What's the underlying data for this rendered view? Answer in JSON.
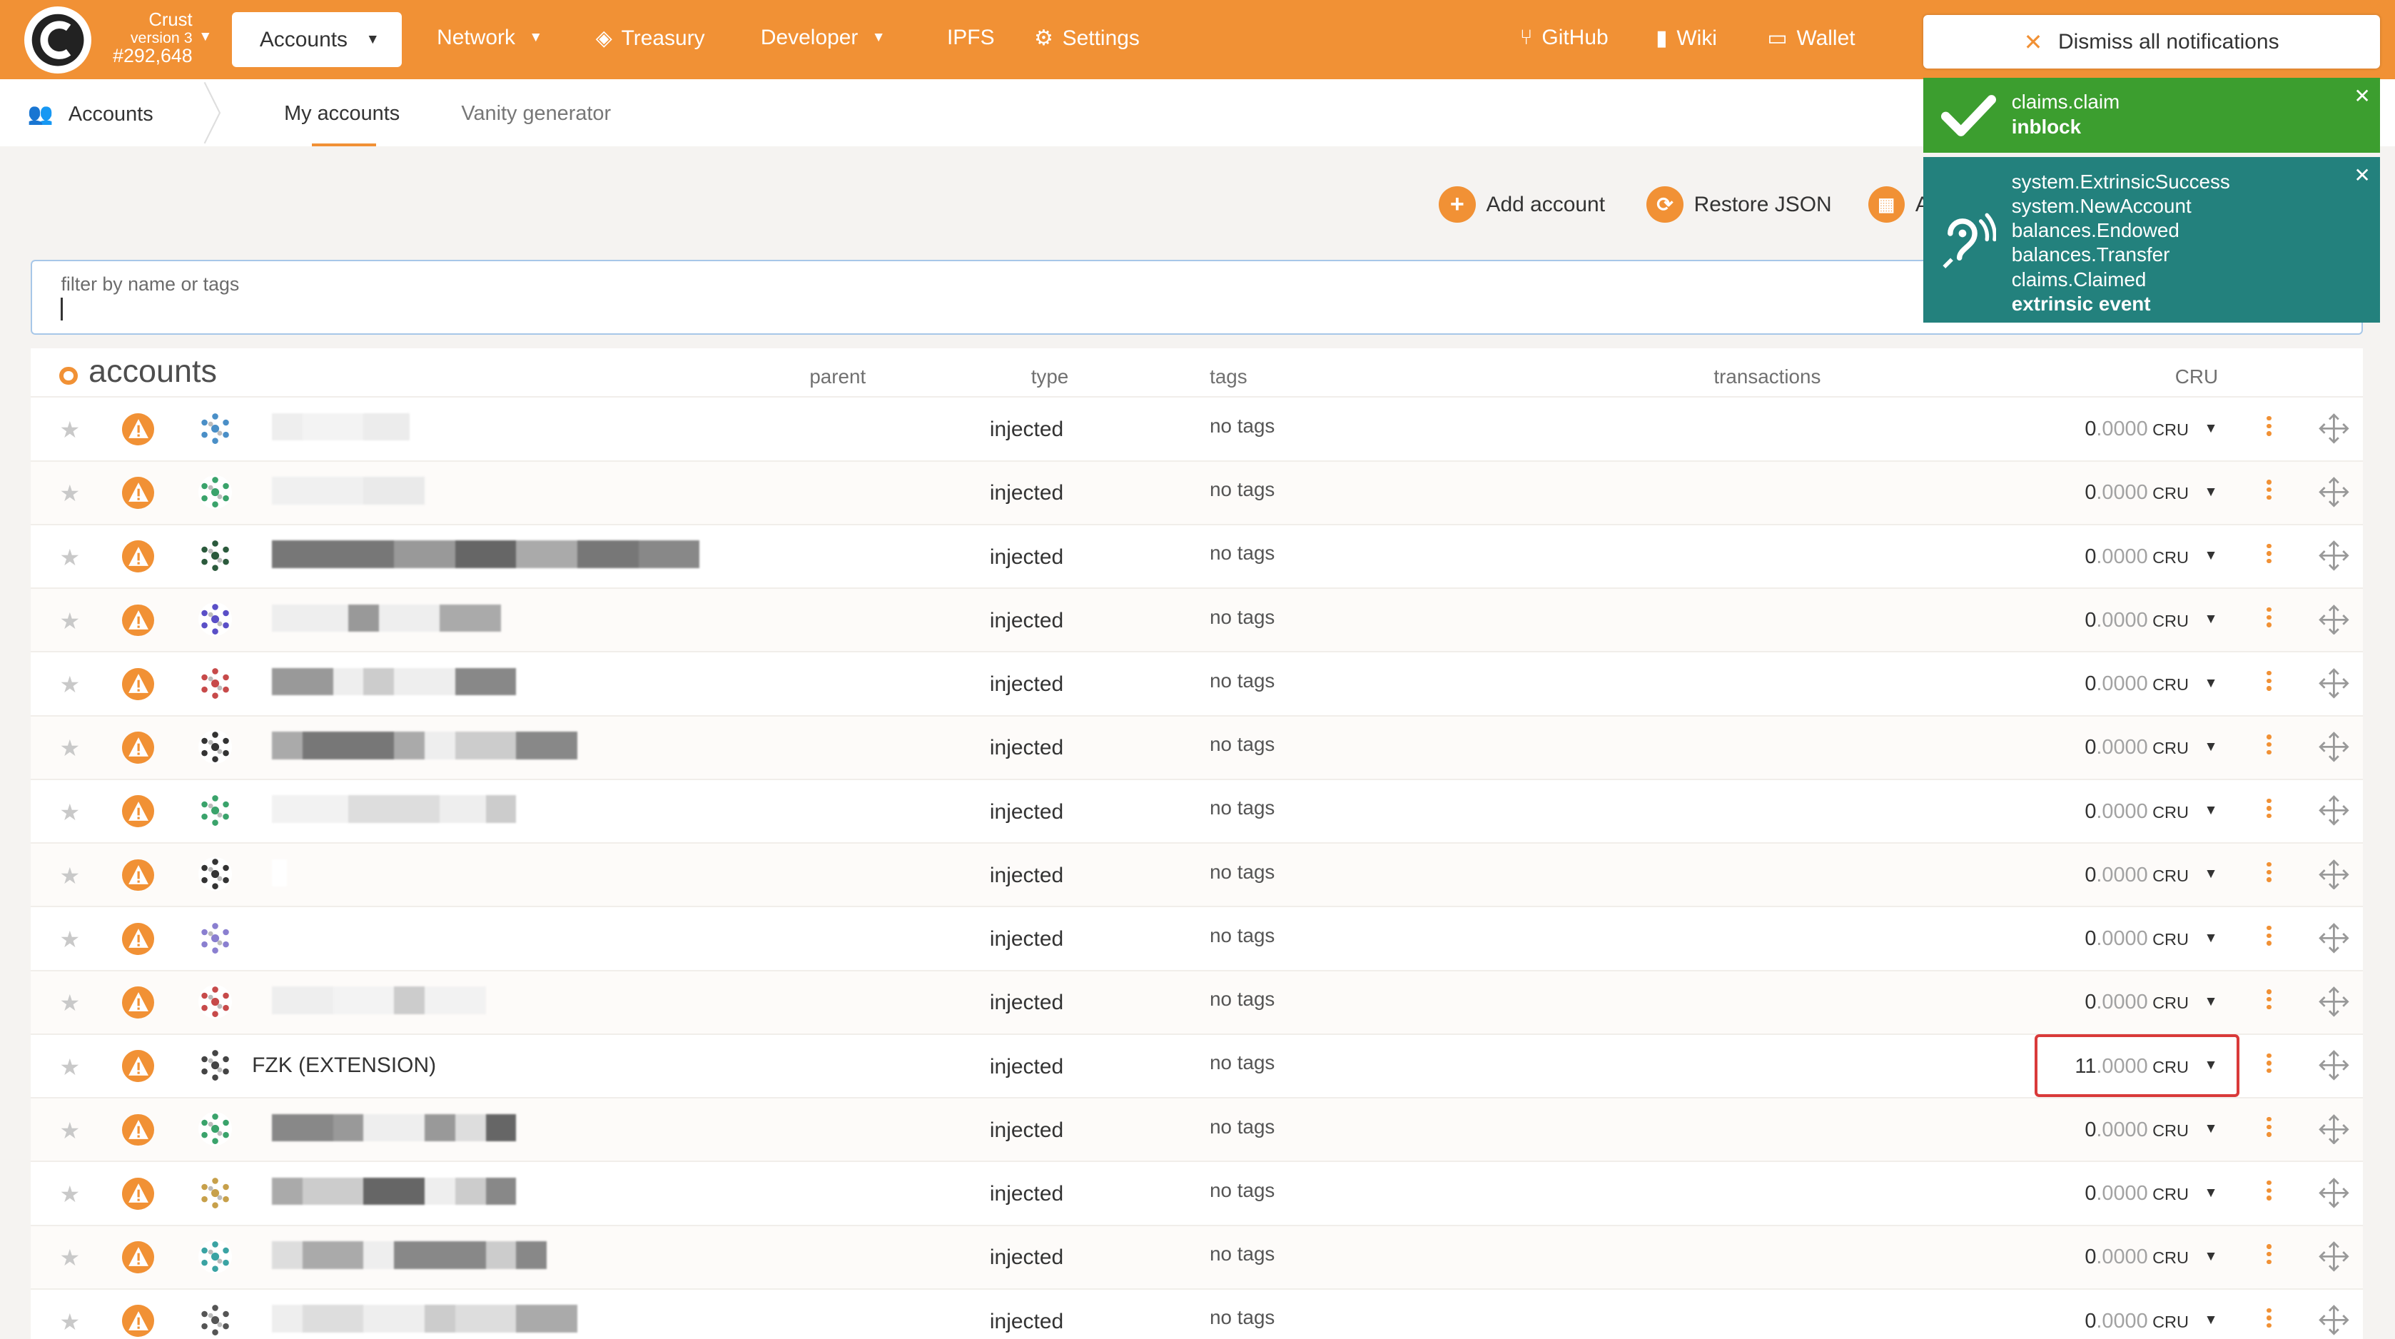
{
  "app": {
    "chain_name": "Crust",
    "version": "version 3",
    "block": "#292,648"
  },
  "nav": {
    "accounts": "Accounts",
    "network": "Network",
    "treasury": "Treasury",
    "developer": "Developer",
    "ipfs": "IPFS",
    "settings": "Settings",
    "github": "GitHub",
    "wiki": "Wiki",
    "wallet": "Wallet"
  },
  "subnav": {
    "breadcrumb": "Accounts",
    "tabs": [
      "My accounts",
      "Vanity generator"
    ],
    "active_tab": "My accounts"
  },
  "toolbar": {
    "add_account": "Add account",
    "restore_json": "Restore JSON",
    "partial_label": "A"
  },
  "filter": {
    "label": "filter by name or tags",
    "value": ""
  },
  "table": {
    "title": "accounts",
    "headers": {
      "parent": "parent",
      "type": "type",
      "tags": "tags",
      "transactions": "transactions",
      "balance": "CRU"
    },
    "rows": [
      {
        "name": "",
        "type": "injected",
        "tags": "no tags",
        "balance_int": "0",
        "balance_dec": ".0000",
        "unit": "CRU"
      },
      {
        "name": "",
        "type": "injected",
        "tags": "no tags",
        "balance_int": "0",
        "balance_dec": ".0000",
        "unit": "CRU"
      },
      {
        "name": "",
        "type": "injected",
        "tags": "no tags",
        "balance_int": "0",
        "balance_dec": ".0000",
        "unit": "CRU"
      },
      {
        "name": "",
        "type": "injected",
        "tags": "no tags",
        "balance_int": "0",
        "balance_dec": ".0000",
        "unit": "CRU"
      },
      {
        "name": "",
        "type": "injected",
        "tags": "no tags",
        "balance_int": "0",
        "balance_dec": ".0000",
        "unit": "CRU"
      },
      {
        "name": "",
        "type": "injected",
        "tags": "no tags",
        "balance_int": "0",
        "balance_dec": ".0000",
        "unit": "CRU"
      },
      {
        "name": "",
        "type": "injected",
        "tags": "no tags",
        "balance_int": "0",
        "balance_dec": ".0000",
        "unit": "CRU"
      },
      {
        "name": "",
        "type": "injected",
        "tags": "no tags",
        "balance_int": "0",
        "balance_dec": ".0000",
        "unit": "CRU"
      },
      {
        "name": "",
        "type": "injected",
        "tags": "no tags",
        "balance_int": "0",
        "balance_dec": ".0000",
        "unit": "CRU"
      },
      {
        "name": "",
        "type": "injected",
        "tags": "no tags",
        "balance_int": "0",
        "balance_dec": ".0000",
        "unit": "CRU"
      },
      {
        "name": "FZK (EXTENSION)",
        "type": "injected",
        "tags": "no tags",
        "balance_int": "11",
        "balance_dec": ".0000",
        "unit": "CRU"
      },
      {
        "name": "",
        "type": "injected",
        "tags": "no tags",
        "balance_int": "0",
        "balance_dec": ".0000",
        "unit": "CRU"
      },
      {
        "name": "",
        "type": "injected",
        "tags": "no tags",
        "balance_int": "0",
        "balance_dec": ".0000",
        "unit": "CRU"
      },
      {
        "name": "",
        "type": "injected",
        "tags": "no tags",
        "balance_int": "0",
        "balance_dec": ".0000",
        "unit": "CRU"
      },
      {
        "name": "",
        "type": "injected",
        "tags": "no tags",
        "balance_int": "0",
        "balance_dec": ".0000",
        "unit": "CRU"
      }
    ]
  },
  "notifications": {
    "dismiss_all": "Dismiss all notifications",
    "items": [
      {
        "status": "success",
        "lines": [
          "claims.claim"
        ],
        "status_text": "inblock"
      },
      {
        "status": "event",
        "lines": [
          "system.ExtrinsicSuccess",
          "system.NewAccount",
          "balances.Endowed",
          "balances.Transfer",
          "claims.Claimed"
        ],
        "status_text": "extrinsic event"
      }
    ]
  },
  "colors": {
    "brand": "#f19135",
    "success": "#3c9e2f",
    "event": "#23817d",
    "highlight": "#d93a3a"
  },
  "icons": {
    "logo": "crust-logo",
    "settings": "gear-icon",
    "github": "github-icon",
    "wiki": "book-icon",
    "wallet": "wallet-icon",
    "row_warning": "warning-icon",
    "row_star": "star-icon"
  }
}
